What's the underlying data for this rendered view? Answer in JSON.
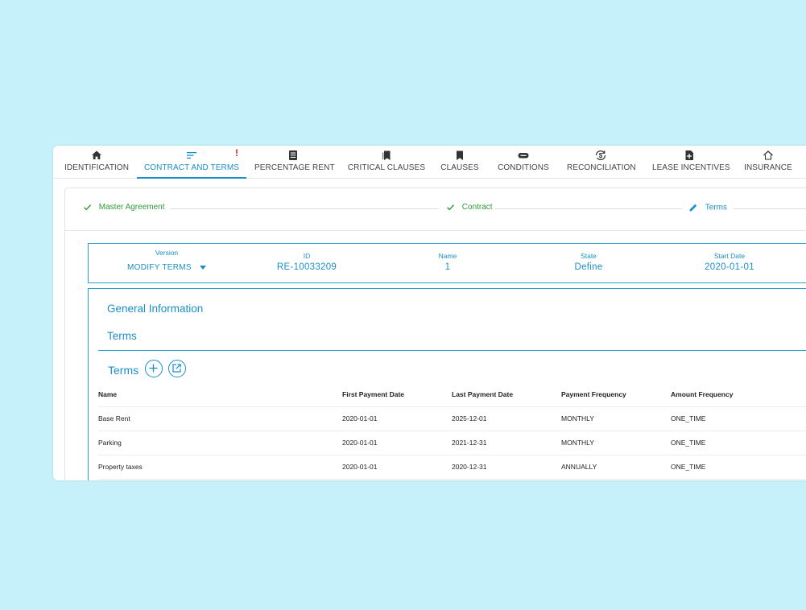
{
  "tabs": [
    {
      "label": "IDENTIFICATION",
      "icon": "home-icon",
      "active": false
    },
    {
      "label": "CONTRACT AND TERMS",
      "icon": "sort-lines-icon",
      "active": true,
      "alert": "!"
    },
    {
      "label": "PERCENTAGE RENT",
      "icon": "document-icon",
      "active": false
    },
    {
      "label": "CRITICAL CLAUSES",
      "icon": "bookmarks-icon",
      "active": false
    },
    {
      "label": "CLAUSES",
      "icon": "bookmark-icon",
      "active": false
    },
    {
      "label": "CONDITIONS",
      "icon": "toggle-icon",
      "active": false
    },
    {
      "label": "RECONCILIATION",
      "icon": "currency-sync-icon",
      "active": false
    },
    {
      "label": "LEASE INCENTIVES",
      "icon": "file-plus-icon",
      "active": false
    },
    {
      "label": "INSURANCE",
      "icon": "house-shield-icon",
      "active": false
    }
  ],
  "stepper": {
    "steps": [
      {
        "label": "Master Agreement",
        "state": "done",
        "icon": "check-icon"
      },
      {
        "label": "Contract",
        "state": "done",
        "icon": "check-icon"
      },
      {
        "label": "Terms",
        "state": "current",
        "icon": "pencil-icon"
      }
    ]
  },
  "info": {
    "version_label": "Version",
    "version_value": "MODIFY TERMS",
    "id_label": "ID",
    "id_value": "RE-10033209",
    "name_label": "Name",
    "name_value": "1",
    "state_label": "State",
    "state_value": "Define",
    "start_label": "Start Date",
    "start_value": "2020-01-01"
  },
  "sections": {
    "general": "General Information",
    "terms": "Terms",
    "terms_table_title": "Terms"
  },
  "table": {
    "columns": [
      "Name",
      "First Payment Date",
      "Last Payment Date",
      "Payment Frequency",
      "Amount Frequency"
    ],
    "rows": [
      [
        "Base Rent",
        "2020-01-01",
        "2025-12-01",
        "MONTHLY",
        "ONE_TIME"
      ],
      [
        "Parking",
        "2020-01-01",
        "2021-12-31",
        "MONTHLY",
        "ONE_TIME"
      ],
      [
        "Property taxes",
        "2020-01-01",
        "2020-12-31",
        "ANNUALLY",
        "ONE_TIME"
      ]
    ]
  },
  "colors": {
    "accent": "#1a8fc7",
    "success": "#2e9a3a",
    "alert": "#e0202a",
    "background": "#c6f0fa"
  }
}
